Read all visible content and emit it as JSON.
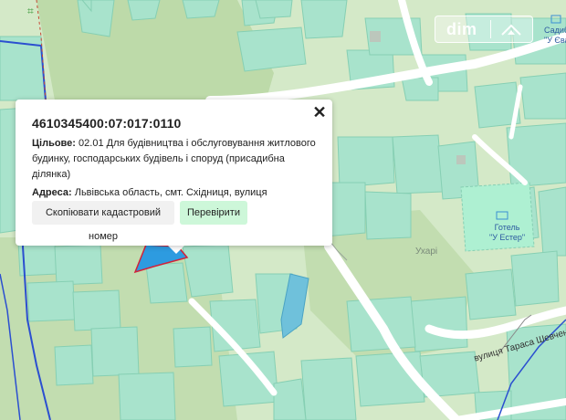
{
  "popup": {
    "cadastral_number": "4610345400:07:017:0110",
    "purpose_label": "Цільове:",
    "purpose_text": "02.01 Для будівництва і обслуговування житлового будинку, господарських будівель і споруд (присадибна ділянка)",
    "address_label": "Адреса:",
    "address_text": "Львівська область, смт. Східниця, вулиця Шевченка, -",
    "copy_button": "Скопіювати кадастровий номер",
    "check_button": "Перевірити",
    "close_symbol": "✕"
  },
  "watermark": {
    "text": "dim"
  },
  "map_labels": {
    "hotel_line1": "Готель",
    "hotel_line2": "\"У Естер\"",
    "place_label": "Ухарі",
    "street_label": "вулиця Тараса Шевченка",
    "top_right_1": "Садиб",
    "top_right_2": "\"У Єва\""
  },
  "colors": {
    "map_background": "#cfe6c4",
    "parcel_fill": "#9ee0c6",
    "parcel_stroke": "#7fc9ad",
    "forest": "#b9d7a6",
    "road": "#ffffff",
    "boundary_blue": "#2b4fd0",
    "selected_parcel": "#2d9be0",
    "selected_outline": "#d2213a",
    "check_button_bg": "#cdf7d9"
  }
}
